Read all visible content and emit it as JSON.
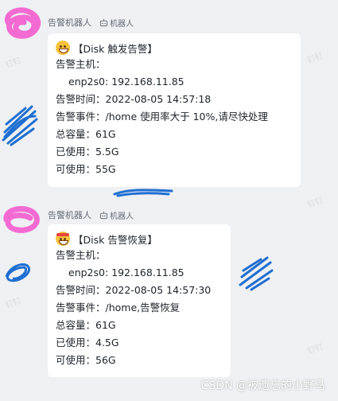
{
  "messages": [
    {
      "sender": "告警机器人",
      "bot_label": "机器人",
      "title": "【Disk 触发告警】",
      "lines": [
        "告警主机：",
        "enp2s0: 192.168.11.85",
        "告警时间：2022-08-05 14:57:18",
        "告警事件：/home 使用率大于 10%,请尽快处理",
        "总容量：61G",
        "已使用：5.5G",
        "可使用：55G"
      ]
    },
    {
      "sender": "告警机器人",
      "bot_label": "机器人",
      "title": "【Disk 告警恢复】",
      "lines": [
        "告警主机：",
        "enp2s0: 192.168.11.85",
        "告警时间：2022-08-05 14:57:30",
        "告警事件：/home,告警恢复",
        "总容量：61G",
        "已使用：4.5G",
        "可使用：56G"
      ]
    }
  ],
  "watermark": "钉钉",
  "footer": "CSDN @被遗忘的小野马",
  "colors": {
    "background": "#eef0f3",
    "bubble": "#ffffff",
    "scribble_pink": "#f36bd2",
    "scribble_blue": "#1f6fd1"
  }
}
